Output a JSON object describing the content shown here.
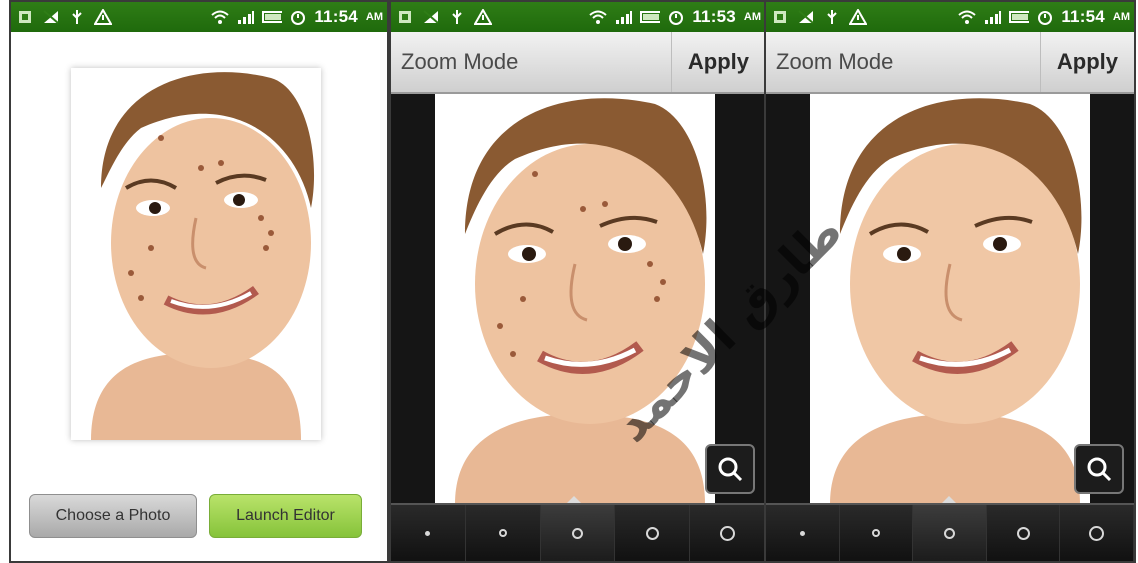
{
  "status_bars": [
    {
      "time": "11:54",
      "ampm": "AM"
    },
    {
      "time": "11:53",
      "ampm": "AM"
    },
    {
      "time": "11:54",
      "ampm": "AM"
    }
  ],
  "status_icons": [
    "storage-icon",
    "no-signal-icon",
    "usb-icon",
    "warning-icon",
    "wifi-icon",
    "signal-icon",
    "battery-icon",
    "alarm-icon"
  ],
  "screen1": {
    "choose_label": "Choose a Photo",
    "launch_label": "Launch Editor"
  },
  "editor_screens": [
    {
      "title": "Zoom Mode",
      "apply_label": "Apply",
      "blemishes": true
    },
    {
      "title": "Zoom Mode",
      "apply_label": "Apply",
      "blemishes": false
    }
  ],
  "brush_sizes": [
    "xs",
    "s",
    "m",
    "l",
    "xl"
  ],
  "selected_brush_index": 2,
  "colors": {
    "statusbar": "#2f7d16",
    "choose_button": "#bfbfbf",
    "launch_button": "#9fd24f",
    "editor_bg": "#151515"
  },
  "watermark": "طارق الاحمد"
}
